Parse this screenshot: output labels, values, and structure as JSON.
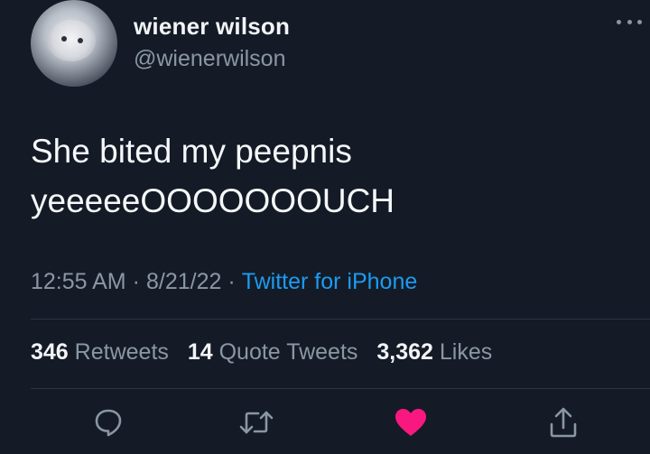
{
  "author": {
    "display_name": "wiener wilson",
    "handle": "@wienerwilson"
  },
  "tweet": {
    "lines": [
      "She bited my peepnis",
      "yeeeeeOOOOOOOUCH"
    ]
  },
  "meta": {
    "time": "12:55 AM",
    "separator": "·",
    "date": "8/21/22",
    "source": "Twitter for iPhone"
  },
  "stats": {
    "retweets_count": "346",
    "retweets_label": "Retweets",
    "quotes_count": "14",
    "quotes_label": "Quote Tweets",
    "likes_count": "3,362",
    "likes_label": "Likes"
  },
  "icons": {
    "reply": "reply-icon",
    "retweet": "retweet-icon",
    "like": "heart-icon",
    "share": "share-icon",
    "more": "more-icon"
  },
  "colors": {
    "background": "#141b26",
    "text_primary": "#f5f7f9",
    "text_secondary": "#8a97a3",
    "link": "#1d9bf0",
    "like_active": "#f91880"
  }
}
